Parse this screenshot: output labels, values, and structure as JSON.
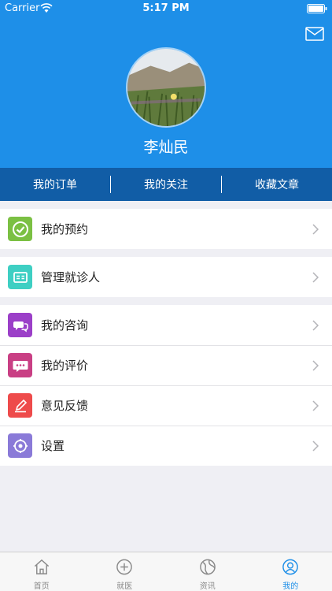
{
  "status_bar": {
    "carrier": "Carrier",
    "time": "5:17 PM"
  },
  "profile": {
    "username": "李灿民"
  },
  "top_tabs": [
    "我的订单",
    "我的关注",
    "收藏文章"
  ],
  "menu": {
    "group1": [
      {
        "label": "我的预约",
        "icon": "check-circle-icon",
        "color": "#7bc043"
      }
    ],
    "group2": [
      {
        "label": "管理就诊人",
        "icon": "id-card-icon",
        "color": "#3ecfc3"
      }
    ],
    "group3": [
      {
        "label": "我的咨询",
        "icon": "chat-bubbles-icon",
        "color": "#9b3fc8"
      },
      {
        "label": "我的评价",
        "icon": "comment-dots-icon",
        "color": "#c93f84"
      },
      {
        "label": "意见反馈",
        "icon": "pencil-icon",
        "color": "#ee4b4b"
      },
      {
        "label": "设置",
        "icon": "settings-icon",
        "color": "#8a7ad8"
      }
    ]
  },
  "tabbar": [
    {
      "label": "首页",
      "icon": "home-icon"
    },
    {
      "label": "就医",
      "icon": "plus-circle-icon"
    },
    {
      "label": "资讯",
      "icon": "globe-icon"
    },
    {
      "label": "我的",
      "icon": "user-icon",
      "active": true
    }
  ],
  "colors": {
    "primary": "#1e8fe8",
    "tabs_bar": "#115da6",
    "background": "#efeff4"
  }
}
